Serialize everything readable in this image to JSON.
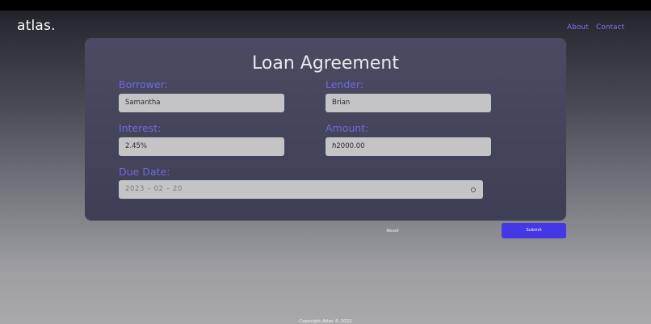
{
  "header": {
    "logo": "atlas.",
    "nav": [
      {
        "label": "About"
      },
      {
        "label": "Contact"
      }
    ]
  },
  "form": {
    "title": "Loan Agreement",
    "borrower": {
      "label": "Borrower:",
      "value": "Samantha"
    },
    "lender": {
      "label": "Lender:",
      "value": "Brian"
    },
    "interest": {
      "label": "Interest:",
      "value": "2.45%"
    },
    "amount": {
      "label": "Amount:",
      "value": "ℏ2000.00"
    },
    "due_date": {
      "label": "Due Date:",
      "value": "2023 – 02 – 20"
    },
    "reset_label": "Reset",
    "submit_label": "Submit"
  },
  "footer": {
    "copyright": "Copyright Atlas © 2022"
  },
  "colors": {
    "accent": "#4536e6",
    "label": "#6f69de",
    "nav": "#7a73ea",
    "card": "#44455b",
    "field": "#c4c4c6"
  }
}
